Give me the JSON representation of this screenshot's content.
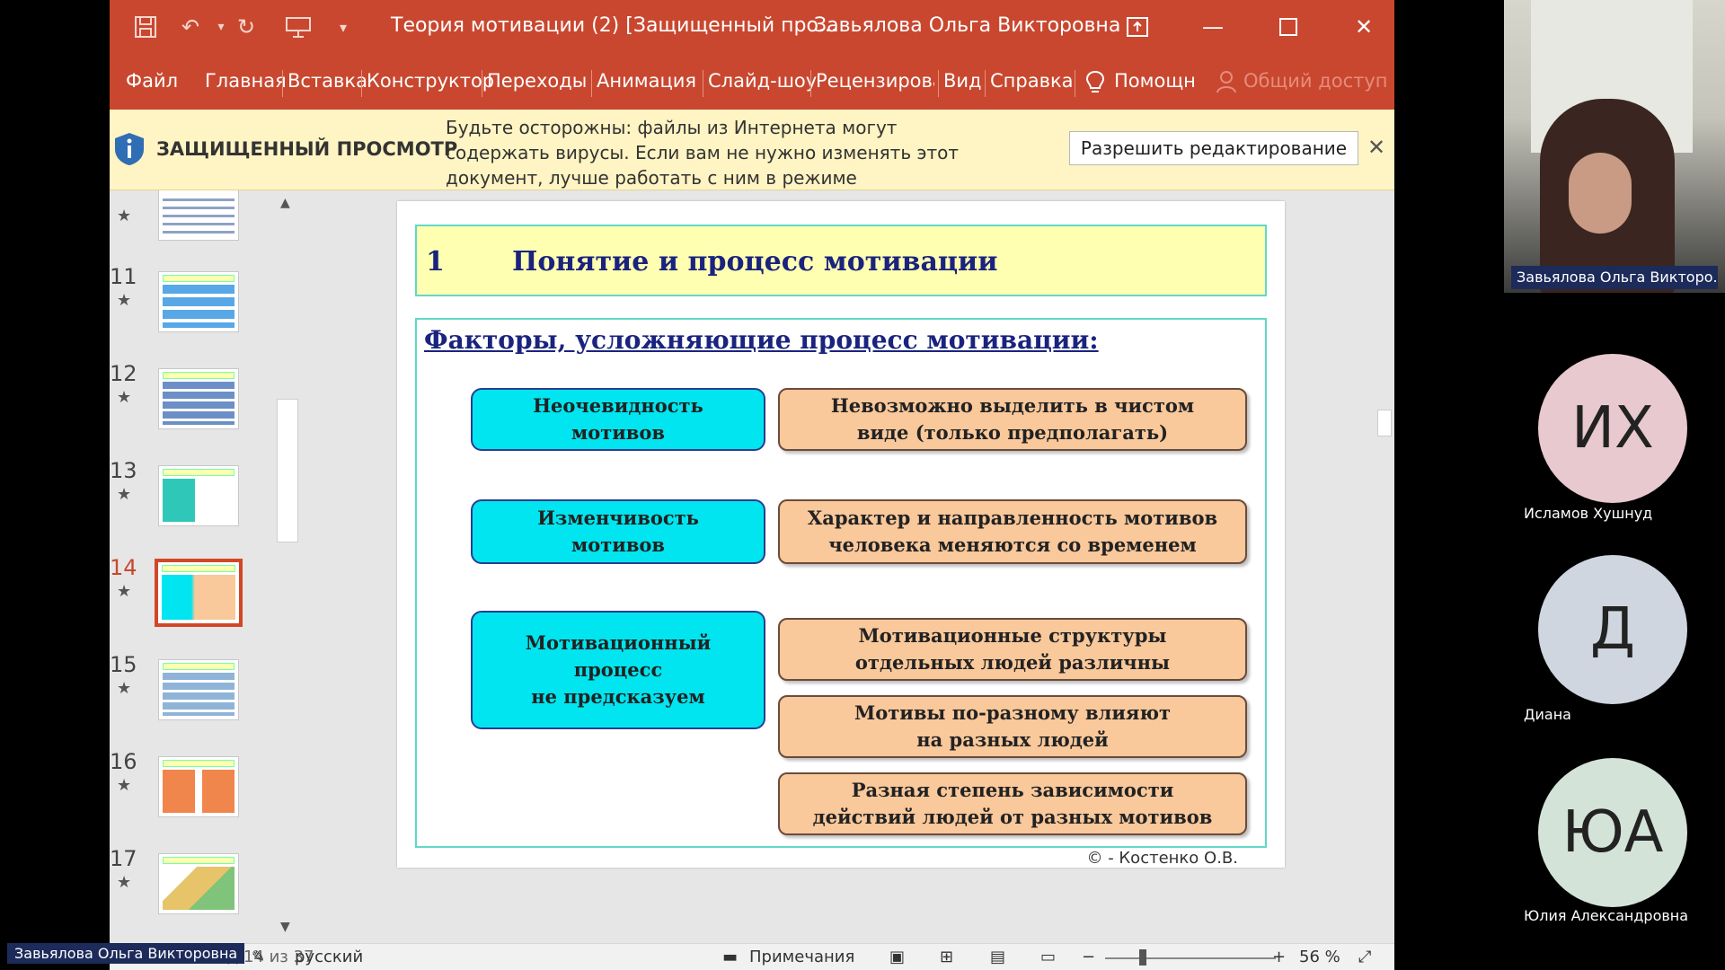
{
  "window": {
    "doc_title": "Теория мотивации (2) [Защищенный про...",
    "user_name": "Завьялова Ольга Викторовна"
  },
  "menu": [
    "Файл",
    "Главная",
    "Вставка",
    "Конструктор",
    "Переходы",
    "Анимация",
    "Слайд-шоу",
    "Рецензирова",
    "Вид",
    "Справка",
    "Помощн",
    "Общий доступ"
  ],
  "infobar": {
    "label": "ЗАЩИЩЕННЫЙ ПРОСМОТР",
    "message": "Будьте осторожны: файлы из Интернета могут содержать вирусы. Если вам не нужно изменять этот документ, лучше работать с ним в режиме защищенного просмотра.",
    "button": "Разрешить редактирование"
  },
  "thumbnails": [
    {
      "number": "",
      "active": false
    },
    {
      "number": "11",
      "active": false
    },
    {
      "number": "12",
      "active": false
    },
    {
      "number": "13",
      "active": false
    },
    {
      "number": "14",
      "active": true
    },
    {
      "number": "15",
      "active": false
    },
    {
      "number": "16",
      "active": false
    },
    {
      "number": "17",
      "active": false
    }
  ],
  "slide": {
    "number": "1",
    "title": "Понятие и процесс мотивации",
    "subtitle": "Факторы, усложняющие процесс мотивации:",
    "left_boxes": [
      "Неочевидность\nмотивов",
      "Изменчивость\nмотивов",
      "Мотивационный\nпроцесс\nне предсказуем"
    ],
    "right_boxes": [
      "Невозможно выделить в чистом\nвиде (только предполагать)",
      "Характер и  направленность мотивов\nчеловека меняются со временем",
      "Мотивационные структуры\nотдельных людей различны",
      "Мотивы по-разному влияют\nна разных людей",
      "Разная степень зависимости\nдействий людей от разных мотивов"
    ],
    "copyright": "© - Костенко О.В."
  },
  "status": {
    "slide_info": "Слайд 14 из 37",
    "language": "русский",
    "notes": "Примечания",
    "zoom": "56 %"
  },
  "conference": {
    "presenter_tag": "Завьялова Ольга Викторовна",
    "video_name": "Завьялова Ольга Викторо...",
    "participants": [
      {
        "initials": "ИХ",
        "name": "Исламов Хушнуд",
        "color": "#e8c9cf"
      },
      {
        "initials": "Д",
        "name": "Диана",
        "color": "#cfd6df"
      },
      {
        "initials": "ЮА",
        "name": "Юлия Александровна",
        "color": "#d3e3d8"
      }
    ]
  }
}
